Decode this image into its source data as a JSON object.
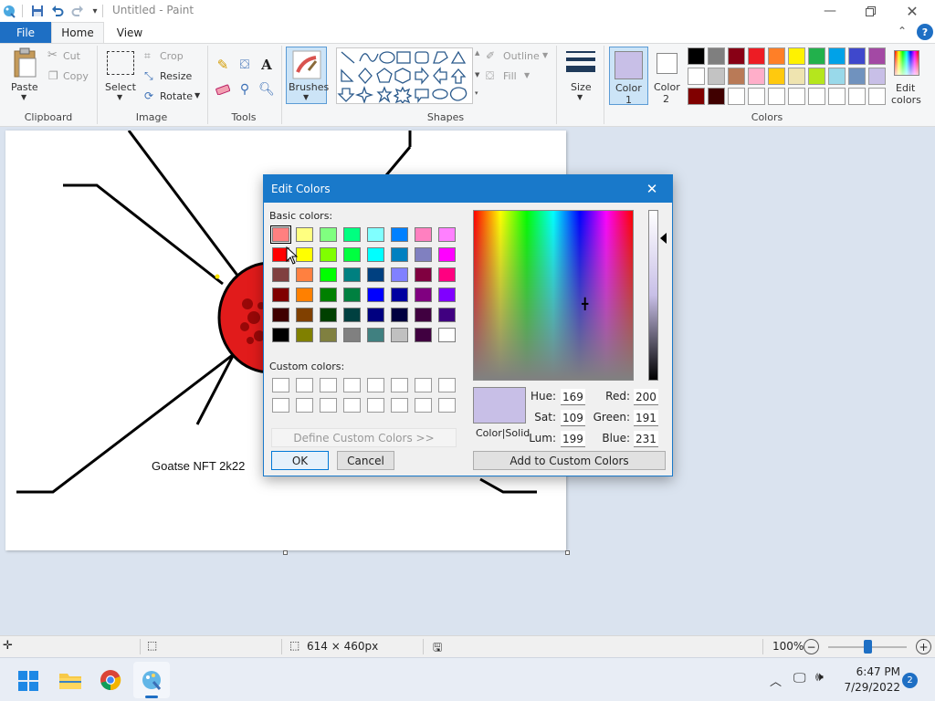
{
  "window": {
    "title": "Untitled - Paint"
  },
  "menu": {
    "file": "File",
    "home": "Home",
    "view": "View"
  },
  "ribbon": {
    "clipboard": {
      "paste": "Paste",
      "cut": "Cut",
      "copy": "Copy",
      "group": "Clipboard"
    },
    "image": {
      "select": "Select",
      "crop": "Crop",
      "resize": "Resize",
      "rotate": "Rotate",
      "group": "Image"
    },
    "tools": {
      "group": "Tools"
    },
    "brushes": "Brushes",
    "shapes": {
      "outline": "Outline",
      "fill": "Fill",
      "group": "Shapes"
    },
    "size": "Size",
    "color1": {
      "line1": "Color",
      "line2": "1",
      "value": "#c8bfe7"
    },
    "color2": {
      "line1": "Color",
      "line2": "2",
      "value": "#ffffff"
    },
    "colors_group": "Colors",
    "edit_colors": {
      "line1": "Edit",
      "line2": "colors"
    },
    "palette": [
      [
        "#000000",
        "#7f7f7f",
        "#880015",
        "#ed1c24",
        "#ff7f27",
        "#fff200",
        "#22b14c",
        "#00a2e8",
        "#3f48cc",
        "#a349a4"
      ],
      [
        "#ffffff",
        "#c3c3c3",
        "#b97a57",
        "#ffaec9",
        "#ffc90e",
        "#efe4b0",
        "#b5e61d",
        "#99d9ea",
        "#7092be",
        "#c8bfe7"
      ],
      [
        "#800000",
        "#400000",
        "#ffffff",
        "#ffffff",
        "#ffffff",
        "#ffffff",
        "#ffffff",
        "#ffffff",
        "#ffffff",
        "#ffffff"
      ]
    ]
  },
  "canvas": {
    "caption": "Goatse NFT 2k22"
  },
  "dialog": {
    "title": "Edit Colors",
    "basic_label": "Basic colors:",
    "custom_label": "Custom colors:",
    "define_button": "Define Custom Colors >>",
    "ok": "OK",
    "cancel": "Cancel",
    "add_button": "Add to Custom Colors",
    "color_solid_label": "Color|Solid",
    "preview_color": "#c8bfe7",
    "hue_label": "Hue:",
    "hue": "169",
    "sat_label": "Sat:",
    "sat": "109",
    "lum_label": "Lum:",
    "lum": "199",
    "red_label": "Red:",
    "red": "200",
    "green_label": "Green:",
    "green": "191",
    "blue_label": "Blue:",
    "blue": "231",
    "basic_colors": [
      [
        "#ff8080",
        "#ffff80",
        "#80ff80",
        "#00ff80",
        "#80ffff",
        "#0080ff",
        "#ff80c0",
        "#ff80ff"
      ],
      [
        "#ff0000",
        "#ffff00",
        "#80ff00",
        "#00ff40",
        "#00ffff",
        "#0080c0",
        "#8080c0",
        "#ff00ff"
      ],
      [
        "#804040",
        "#ff8040",
        "#00ff00",
        "#008080",
        "#004080",
        "#8080ff",
        "#800040",
        "#ff0080"
      ],
      [
        "#800000",
        "#ff8000",
        "#008000",
        "#008040",
        "#0000ff",
        "#0000a0",
        "#800080",
        "#8000ff"
      ],
      [
        "#400000",
        "#804000",
        "#004000",
        "#004040",
        "#000080",
        "#000040",
        "#400040",
        "#400080"
      ],
      [
        "#000000",
        "#808000",
        "#808040",
        "#808080",
        "#408080",
        "#c0c0c0",
        "#400040",
        "#ffffff"
      ]
    ]
  },
  "statusbar": {
    "dimensions": "614 × 460px",
    "zoom": "100%",
    "zoom_value": 0.5
  },
  "taskbar": {
    "time": "6:47 PM",
    "date": "7/29/2022",
    "notifications": "2"
  }
}
